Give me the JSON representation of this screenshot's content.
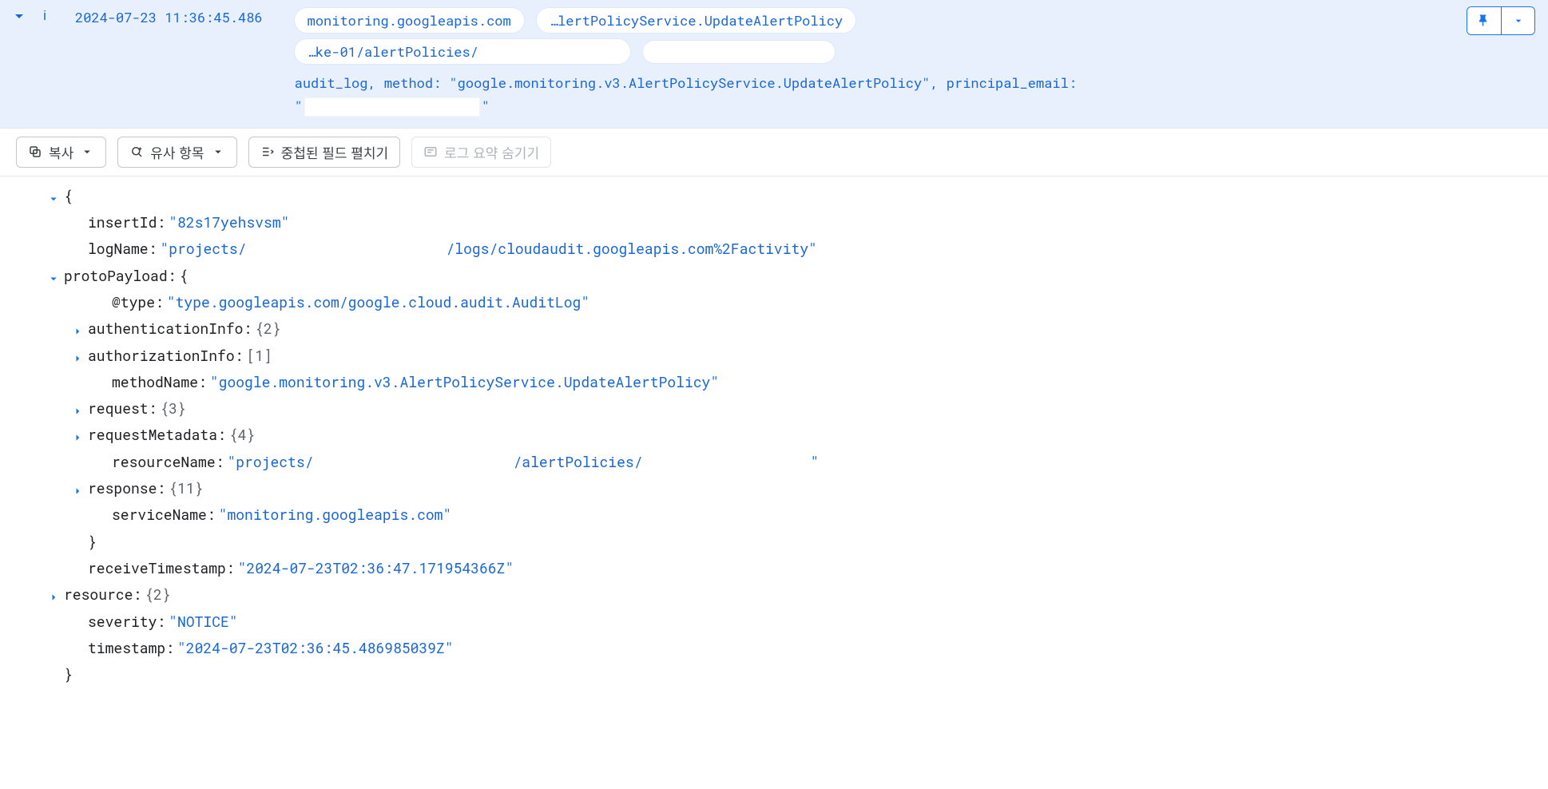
{
  "header": {
    "severity_letter": "i",
    "timestamp": "2024-07-23 11:36:45.486",
    "chips": [
      "monitoring.googleapis.com",
      "…lertPolicyService.UpdateAlertPolicy",
      "…ke-01/alertPolicies/"
    ],
    "summary_prefix": "audit_log, method: ",
    "summary_method": "\"google.monitoring.v3.AlertPolicyService.UpdateAlertPolicy\"",
    "summary_suffix": ", principal_email:",
    "summary_line2_open": "\"",
    "summary_line2_close": "\""
  },
  "toolbar": {
    "copy": "복사",
    "similar": "유사 항목",
    "expand": "중첩된 필드 펼치기",
    "hide_summary": "로그 요약 숨기기"
  },
  "json": {
    "open": "{",
    "insertId_k": "insertId",
    "insertId_v": "\"82s17yehsvsm\"",
    "logName_k": "logName",
    "logName_v1": "\"projects/",
    "logName_v2": "/logs/cloudaudit.googleapis.com%2Factivity\"",
    "protoPayload_k": "protoPayload",
    "protoPayload_open": "{",
    "type_k": "@type",
    "type_v": "\"type.googleapis.com/google.cloud.audit.AuditLog\"",
    "authInfo_k": "authenticationInfo",
    "authInfo_v": "{2}",
    "authzInfo_k": "authorizationInfo",
    "authzInfo_v": "[1]",
    "methodName_k": "methodName",
    "methodName_v": "\"google.monitoring.v3.AlertPolicyService.UpdateAlertPolicy\"",
    "request_k": "request",
    "request_v": "{3}",
    "reqMeta_k": "requestMetadata",
    "reqMeta_v": "{4}",
    "resName_k": "resourceName",
    "resName_v1": "\"projects/",
    "resName_v2": "/alertPolicies/",
    "resName_v3": "\"",
    "response_k": "response",
    "response_v": "{11}",
    "serviceName_k": "serviceName",
    "serviceName_v": "\"monitoring.googleapis.com\"",
    "protoPayload_close": "}",
    "recvTs_k": "receiveTimestamp",
    "recvTs_v": "\"2024-07-23T02:36:47.171954366Z\"",
    "resource_k": "resource",
    "resource_v": "{2}",
    "severity_k": "severity",
    "severity_v": "\"NOTICE\"",
    "timestamp_k": "timestamp",
    "timestamp_v": "\"2024-07-23T02:36:45.486985039Z\"",
    "close": "}"
  }
}
